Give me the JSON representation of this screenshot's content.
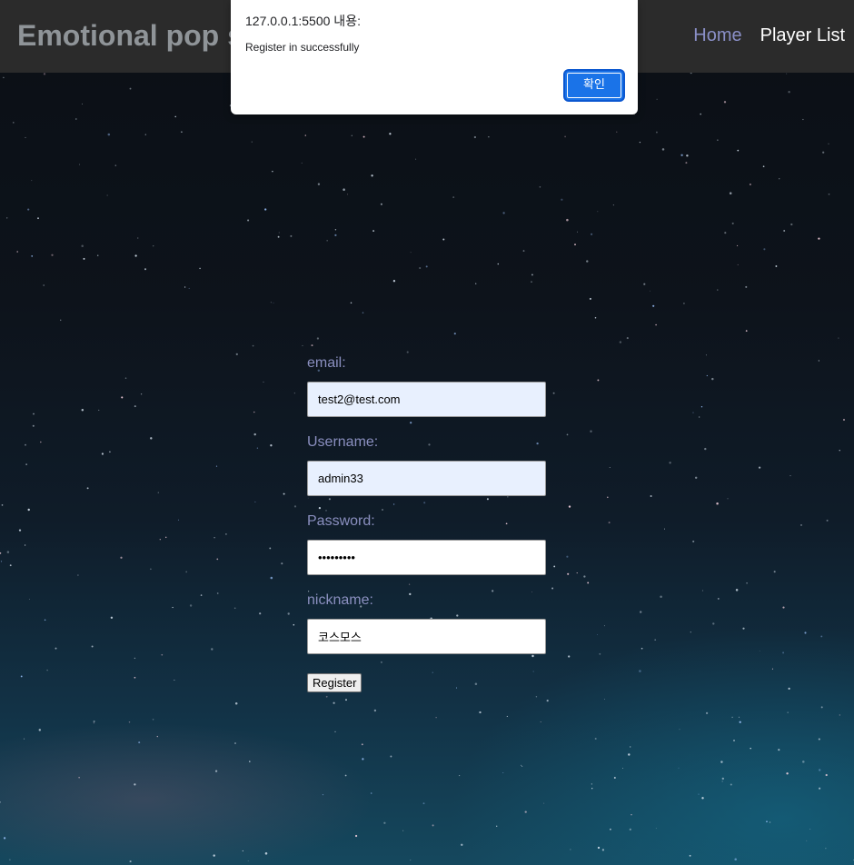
{
  "navbar": {
    "brand": "Emotional pop s",
    "links": [
      {
        "label": "Home"
      },
      {
        "label": "Player List"
      }
    ]
  },
  "form": {
    "email": {
      "label": "email:",
      "value": "test2@test.com"
    },
    "username": {
      "label": "Username:",
      "value": "admin33"
    },
    "password": {
      "label": "Password:",
      "value": "•••••••••"
    },
    "nickname": {
      "label": "nickname:",
      "value": "코스모스"
    },
    "submit_label": "Register"
  },
  "dialog": {
    "title": "127.0.0.1:5500 내용:",
    "message": "Register in successfully",
    "ok_label": "확인"
  },
  "colors": {
    "navbar_bg": "#2b2b2b",
    "brand": "#8f9498",
    "nav_home": "#8a8fc7",
    "label": "#8a8fbf",
    "dialog_button": "#1a73e8"
  }
}
